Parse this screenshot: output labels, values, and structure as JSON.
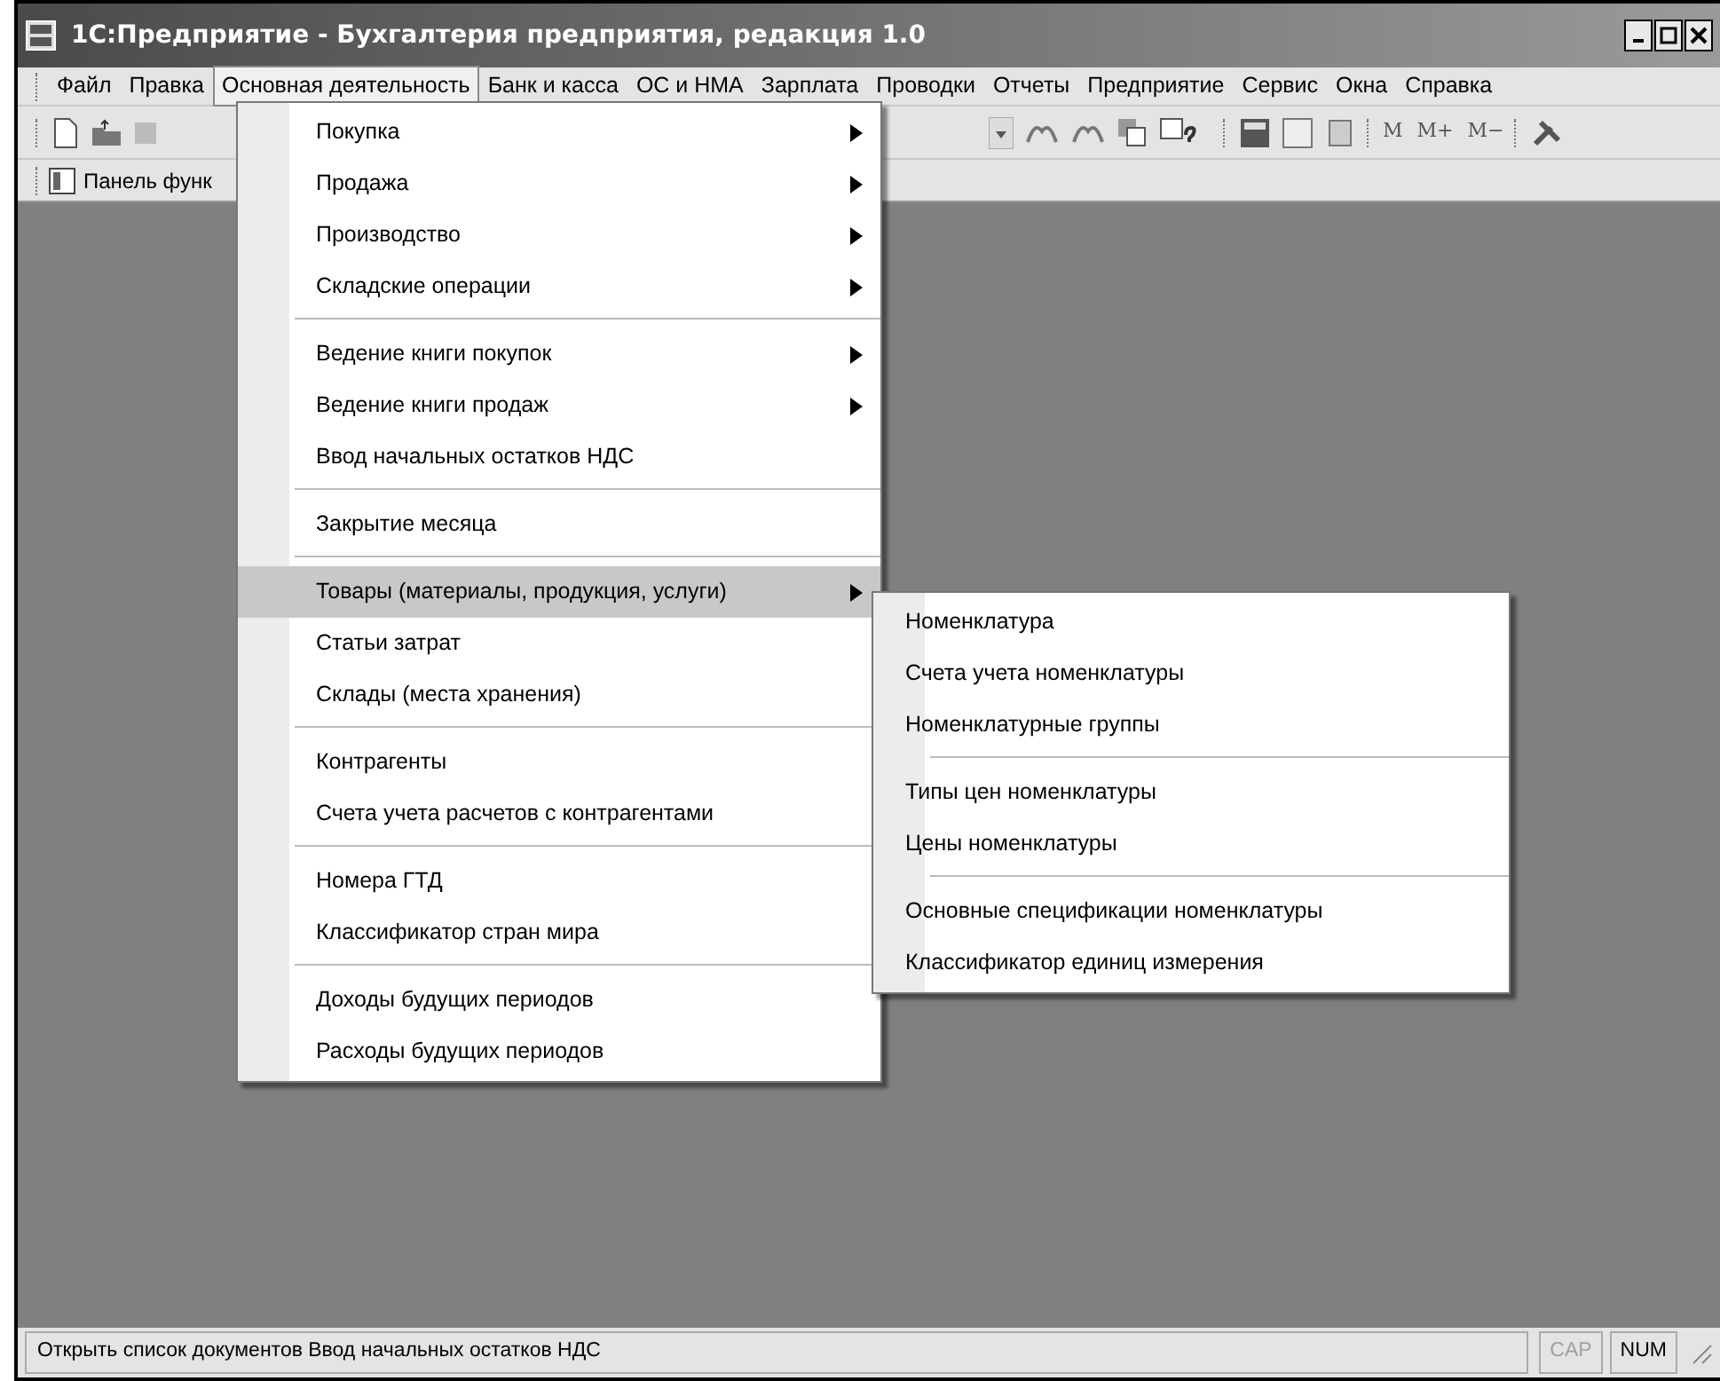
{
  "window": {
    "title": "1С:Предприятие - Бухгалтерия предприятия, редакция 1.0"
  },
  "menu_bar": [
    {
      "label": "Файл",
      "selected": false
    },
    {
      "label": "Правка",
      "selected": false
    },
    {
      "label": "Основная деятельность",
      "selected": true
    },
    {
      "label": "Банк и касса",
      "selected": false
    },
    {
      "label": "ОС и НМА",
      "selected": false
    },
    {
      "label": "Зарплата",
      "selected": false
    },
    {
      "label": "Проводки",
      "selected": false
    },
    {
      "label": "Отчеты",
      "selected": false
    },
    {
      "label": "Предприятие",
      "selected": false
    },
    {
      "label": "Сервис",
      "selected": false
    },
    {
      "label": "Окна",
      "selected": false
    },
    {
      "label": "Справка",
      "selected": false
    }
  ],
  "toolbar": {
    "memory_buttons": [
      "M",
      "M+",
      "M−"
    ]
  },
  "function_panel": {
    "label": "Панель функ"
  },
  "dropdown": [
    {
      "kind": "item",
      "label": "Покупка",
      "submenu": true,
      "selected": false
    },
    {
      "kind": "item",
      "label": "Продажа",
      "submenu": true,
      "selected": false
    },
    {
      "kind": "item",
      "label": "Производство",
      "submenu": true,
      "selected": false
    },
    {
      "kind": "item",
      "label": "Складские операции",
      "submenu": true,
      "selected": false
    },
    {
      "kind": "separator"
    },
    {
      "kind": "item",
      "label": "Ведение книги покупок",
      "submenu": true,
      "selected": false
    },
    {
      "kind": "item",
      "label": "Ведение книги продаж",
      "submenu": true,
      "selected": false
    },
    {
      "kind": "item",
      "label": "Ввод начальных остатков НДС",
      "submenu": false,
      "selected": false
    },
    {
      "kind": "separator"
    },
    {
      "kind": "item",
      "label": "Закрытие месяца",
      "submenu": false,
      "selected": false
    },
    {
      "kind": "separator"
    },
    {
      "kind": "item",
      "label": "Товары (материалы, продукция, услуги)",
      "submenu": true,
      "selected": true
    },
    {
      "kind": "item",
      "label": "Статьи затрат",
      "submenu": false,
      "selected": false
    },
    {
      "kind": "item",
      "label": "Склады (места хранения)",
      "submenu": false,
      "selected": false
    },
    {
      "kind": "separator"
    },
    {
      "kind": "item",
      "label": "Контрагенты",
      "submenu": false,
      "selected": false
    },
    {
      "kind": "item",
      "label": "Счета учета расчетов с контрагентами",
      "submenu": false,
      "selected": false
    },
    {
      "kind": "separator"
    },
    {
      "kind": "item",
      "label": "Номера ГТД",
      "submenu": false,
      "selected": false
    },
    {
      "kind": "item",
      "label": "Классификатор стран мира",
      "submenu": false,
      "selected": false
    },
    {
      "kind": "separator"
    },
    {
      "kind": "item",
      "label": "Доходы будущих периодов",
      "submenu": false,
      "selected": false
    },
    {
      "kind": "item",
      "label": "Расходы будущих периодов",
      "submenu": false,
      "selected": false
    }
  ],
  "submenu": [
    {
      "kind": "item",
      "label": "Номенклатура"
    },
    {
      "kind": "item",
      "label": "Счета учета номенклатуры"
    },
    {
      "kind": "item",
      "label": "Номенклатурные группы"
    },
    {
      "kind": "separator"
    },
    {
      "kind": "item",
      "label": "Типы цен номенклатуры"
    },
    {
      "kind": "item",
      "label": "Цены номенклатуры"
    },
    {
      "kind": "separator"
    },
    {
      "kind": "item",
      "label": "Основные спецификации номенклатуры"
    },
    {
      "kind": "item",
      "label": "Классификатор единиц измерения"
    }
  ],
  "status_bar": {
    "text": "Открыть список документов Ввод начальных остатков НДС",
    "indicators": [
      {
        "label": "CAP",
        "disabled": true
      },
      {
        "label": "NUM",
        "disabled": false
      }
    ]
  }
}
